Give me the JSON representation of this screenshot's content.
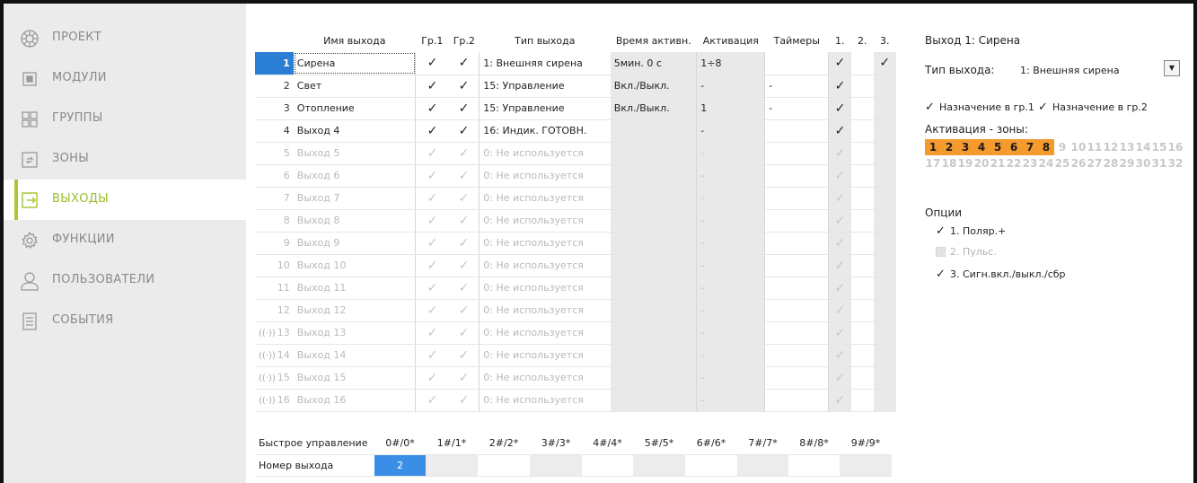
{
  "sidebar": {
    "items": [
      {
        "label": "ПРОЕКТ",
        "icon": "project-icon",
        "active": false
      },
      {
        "label": "МОДУЛИ",
        "icon": "modules-icon",
        "active": false
      },
      {
        "label": "ГРУППЫ",
        "icon": "groups-icon",
        "active": false
      },
      {
        "label": "ЗОНЫ",
        "icon": "zones-icon",
        "active": false
      },
      {
        "label": "ВЫХОДЫ",
        "icon": "outputs-icon",
        "active": true
      },
      {
        "label": "ФУНКЦИИ",
        "icon": "gear-icon",
        "active": false
      },
      {
        "label": "ПОЛЬЗОВАТЕЛИ",
        "icon": "user-icon",
        "active": false
      },
      {
        "label": "СОБЫТИЯ",
        "icon": "events-icon",
        "active": false
      }
    ]
  },
  "table": {
    "headers": {
      "name": "Имя выхода",
      "g1": "Гр.1",
      "g2": "Гр.2",
      "type": "Тип выхода",
      "time": "Время активн.",
      "activation": "Активация",
      "timers": "Таймеры",
      "o1": "1.",
      "o2": "2.",
      "o3": "3."
    },
    "rows": [
      {
        "num": "1",
        "name": "Сирена",
        "g1": "✓",
        "g2": "✓",
        "type": "1: Внешняя сирена",
        "time": "5мин. 0 с",
        "activation": "1÷8",
        "timers": "",
        "o1": "✓",
        "o2": "",
        "o3": "✓"
      },
      {
        "num": "2",
        "name": "Свет",
        "g1": "✓",
        "g2": "✓",
        "type": "15: Управление",
        "time": "Вкл./Выкл.",
        "activation": "-",
        "timers": "-",
        "o1": "✓",
        "o2": "",
        "o3": ""
      },
      {
        "num": "3",
        "name": "Отопление",
        "g1": "✓",
        "g2": "✓",
        "type": "15: Управление",
        "time": "Вкл./Выкл.",
        "activation": "1",
        "timers": "-",
        "o1": "✓",
        "o2": "",
        "o3": ""
      },
      {
        "num": "4",
        "name": "Выход  4",
        "g1": "✓",
        "g2": "✓",
        "type": "16: Индик. ГОТОВН.",
        "time": "",
        "activation": "-",
        "timers": "",
        "o1": "✓",
        "o2": "",
        "o3": ""
      },
      {
        "num": "5",
        "name": "Выход  5",
        "g1": "✓",
        "g2": "✓",
        "type": "0: Не используется",
        "time": "",
        "activation": "-",
        "timers": "",
        "o1": "✓",
        "o2": "",
        "o3": ""
      },
      {
        "num": "6",
        "name": "Выход  6",
        "g1": "✓",
        "g2": "✓",
        "type": "0: Не используется",
        "time": "",
        "activation": "-",
        "timers": "",
        "o1": "✓",
        "o2": "",
        "o3": ""
      },
      {
        "num": "7",
        "name": "Выход  7",
        "g1": "✓",
        "g2": "✓",
        "type": "0: Не используется",
        "time": "",
        "activation": "-",
        "timers": "",
        "o1": "✓",
        "o2": "",
        "o3": ""
      },
      {
        "num": "8",
        "name": "Выход  8",
        "g1": "✓",
        "g2": "✓",
        "type": "0: Не используется",
        "time": "",
        "activation": "-",
        "timers": "",
        "o1": "✓",
        "o2": "",
        "o3": ""
      },
      {
        "num": "9",
        "name": "Выход  9",
        "g1": "✓",
        "g2": "✓",
        "type": "0: Не используется",
        "time": "",
        "activation": "-",
        "timers": "",
        "o1": "✓",
        "o2": "",
        "o3": ""
      },
      {
        "num": "10",
        "name": "Выход 10",
        "g1": "✓",
        "g2": "✓",
        "type": "0: Не используется",
        "time": "",
        "activation": "-",
        "timers": "",
        "o1": "✓",
        "o2": "",
        "o3": ""
      },
      {
        "num": "11",
        "name": "Выход 11",
        "g1": "✓",
        "g2": "✓",
        "type": "0: Не используется",
        "time": "",
        "activation": "-",
        "timers": "",
        "o1": "✓",
        "o2": "",
        "o3": ""
      },
      {
        "num": "12",
        "name": "Выход 12",
        "g1": "✓",
        "g2": "✓",
        "type": "0: Не используется",
        "time": "",
        "activation": "-",
        "timers": "",
        "o1": "✓",
        "o2": "",
        "o3": ""
      },
      {
        "num": "13",
        "name": "Выход 13",
        "g1": "✓",
        "g2": "✓",
        "type": "0: Не используется",
        "time": "",
        "activation": "-",
        "timers": "",
        "o1": "✓",
        "o2": "",
        "o3": "",
        "wireless": true
      },
      {
        "num": "14",
        "name": "Выход 14",
        "g1": "✓",
        "g2": "✓",
        "type": "0: Не используется",
        "time": "",
        "activation": "-",
        "timers": "",
        "o1": "✓",
        "o2": "",
        "o3": "",
        "wireless": true
      },
      {
        "num": "15",
        "name": "Выход 15",
        "g1": "✓",
        "g2": "✓",
        "type": "0: Не используется",
        "time": "",
        "activation": "-",
        "timers": "",
        "o1": "✓",
        "o2": "",
        "o3": "",
        "wireless": true
      },
      {
        "num": "16",
        "name": "Выход 16",
        "g1": "✓",
        "g2": "✓",
        "type": "0: Не используется",
        "time": "",
        "activation": "-",
        "timers": "",
        "o1": "✓",
        "o2": "",
        "o3": "",
        "wireless": true
      }
    ]
  },
  "quick": {
    "label": "Быстрое управление",
    "keys": [
      "0#/0*",
      "1#/1*",
      "2#/2*",
      "3#/3*",
      "4#/4*",
      "5#/5*",
      "6#/6*",
      "7#/7*",
      "8#/8*",
      "9#/9*"
    ],
    "out_label": "Номер выхода",
    "out_values": [
      "2",
      "",
      "",
      "",
      "",
      "",
      "",
      "",
      "",
      ""
    ]
  },
  "panel": {
    "title": "Выход 1: Сирена",
    "type_label": "Тип выхода:",
    "type_value": "1: Внешняя сирена",
    "assign_g1": "Назначение в гр.1",
    "assign_g2": "Назначение в гр.2",
    "zones_label": "Активация - зоны:",
    "zones": [
      {
        "n": "1",
        "on": true
      },
      {
        "n": "2",
        "on": true
      },
      {
        "n": "3",
        "on": true
      },
      {
        "n": "4",
        "on": true
      },
      {
        "n": "5",
        "on": true
      },
      {
        "n": "6",
        "on": true
      },
      {
        "n": "7",
        "on": true
      },
      {
        "n": "8",
        "on": true
      },
      {
        "n": "9",
        "on": false
      },
      {
        "n": "10",
        "on": false
      },
      {
        "n": "11",
        "on": false
      },
      {
        "n": "12",
        "on": false
      },
      {
        "n": "13",
        "on": false
      },
      {
        "n": "14",
        "on": false
      },
      {
        "n": "15",
        "on": false
      },
      {
        "n": "16",
        "on": false
      },
      {
        "n": "17",
        "on": false
      },
      {
        "n": "18",
        "on": false
      },
      {
        "n": "19",
        "on": false
      },
      {
        "n": "20",
        "on": false
      },
      {
        "n": "21",
        "on": false
      },
      {
        "n": "22",
        "on": false
      },
      {
        "n": "23",
        "on": false
      },
      {
        "n": "24",
        "on": false
      },
      {
        "n": "25",
        "on": false
      },
      {
        "n": "26",
        "on": false
      },
      {
        "n": "27",
        "on": false
      },
      {
        "n": "28",
        "on": false
      },
      {
        "n": "29",
        "on": false
      },
      {
        "n": "30",
        "on": false
      },
      {
        "n": "31",
        "on": false
      },
      {
        "n": "32",
        "on": false
      }
    ],
    "options_label": "Опции",
    "options": [
      {
        "label": "1. Поляр.+",
        "checked": true,
        "enabled": true
      },
      {
        "label": "2. Пульс.",
        "checked": false,
        "enabled": false
      },
      {
        "label": "3. Сигн.вкл./выкл./сбр",
        "checked": true,
        "enabled": true
      }
    ],
    "check_glyph": "✓",
    "dropdown_glyph": "▼"
  },
  "colors": {
    "accent": "#a8c83a",
    "selection": "#2a7fd4",
    "zone_active": "#f59a2c",
    "sidebar_bg": "#ebebeb"
  }
}
